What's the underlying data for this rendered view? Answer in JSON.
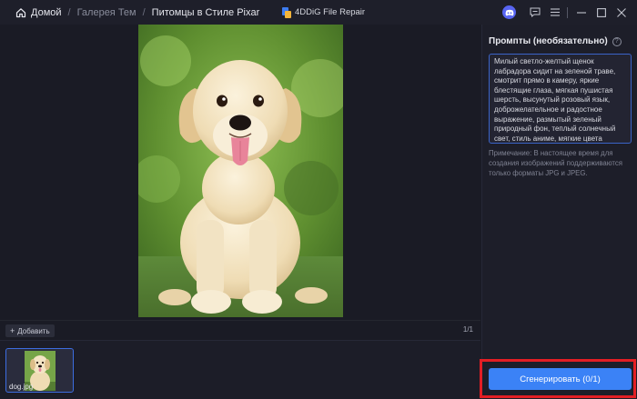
{
  "breadcrumb": {
    "home": "Домой",
    "items": [
      "Галерея Тем",
      "Питомцы в Стиле Pixar"
    ],
    "separator": "/"
  },
  "app": {
    "title": "4DDiG File Repair"
  },
  "window_controls": {
    "icons": [
      "discord-icon",
      "feedback-icon",
      "menu-icon",
      "minimize-icon",
      "maximize-icon",
      "close-icon"
    ]
  },
  "prompt_panel": {
    "title": "Промпты (необязательно)",
    "help": "?",
    "prompt_text": "Милый светло-желтый щенок лабрадора сидит на зеленой траве, смотрит прямо в камеру, яркие блестящие глаза, мягкая пушистая шерсть, высунутый розовый язык, доброжелательное и радостное выражение, размытый зеленый природный фон, теплый солнечный свет, стиль аниме, мягкие цвета",
    "note": "Примечание: В настоящее время для создания изображений поддерживаются только форматы JPG и JPEG."
  },
  "toolbar": {
    "add_label": "Добавить",
    "add_icon": "+",
    "page_count": "1/1"
  },
  "thumbnails": [
    {
      "filename": "dog.jpg"
    }
  ],
  "generate": {
    "label": "Сгенерировать (0/1)"
  },
  "colors": {
    "accent": "#3b82f6",
    "highlight": "#e31e24",
    "background": "#1a1b25"
  }
}
